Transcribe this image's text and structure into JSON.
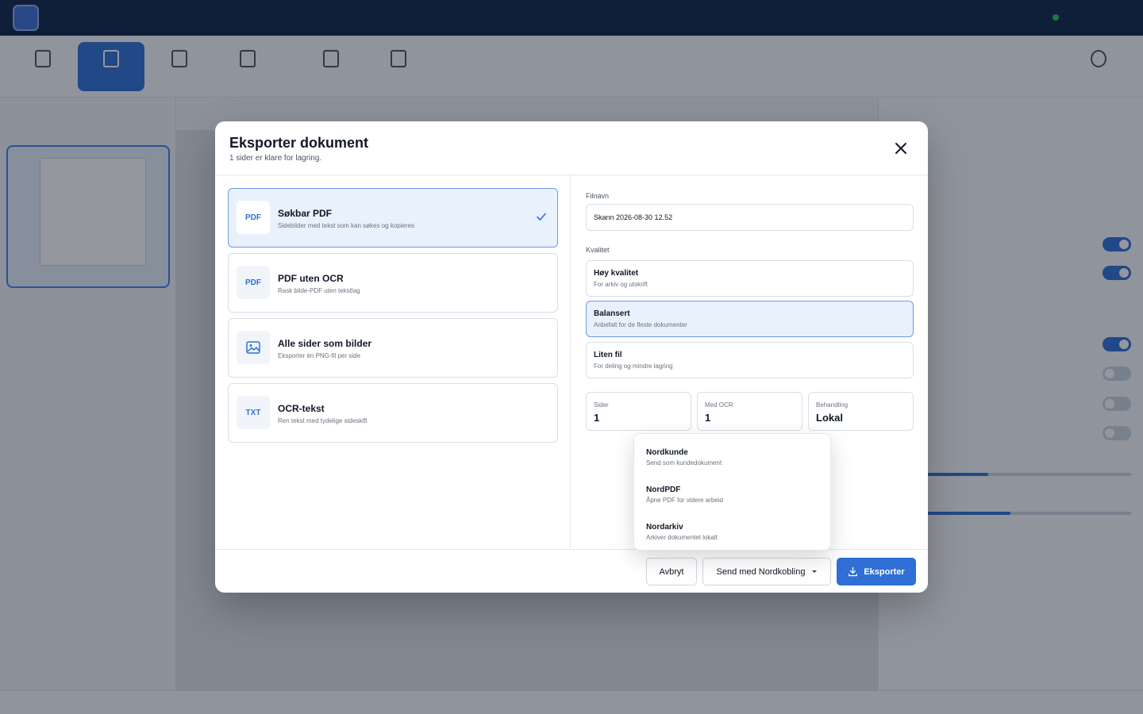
{
  "colors": {
    "accent": "#2f6fd6",
    "selected_bg": "#e9f1fd",
    "titlebar": "#0f2547"
  },
  "modal": {
    "title": "Eksporter dokument",
    "subtitle": "1 sider er klare for lagring.",
    "formats": [
      {
        "icon": "PDF",
        "name": "Søkbar PDF",
        "desc": "Sidebilder med tekst som kan søkes og kopieres",
        "selected": true
      },
      {
        "icon": "PDF",
        "name": "PDF uten OCR",
        "desc": "Rask bilde-PDF uten tekstlag",
        "selected": false
      },
      {
        "icon": "image-icon",
        "name": "Alle sider som bilder",
        "desc": "Eksporter én PNG-fil per side",
        "selected": false
      },
      {
        "icon": "TXT",
        "name": "OCR-tekst",
        "desc": "Ren tekst med tydelige sideskift",
        "selected": false
      }
    ],
    "filename_label": "Filnavn",
    "filename_value": "Skann 2026-08-30 12.52",
    "quality_label": "Kvalitet",
    "qualities": [
      {
        "name": "Høy kvalitet",
        "desc": "For arkiv og utskrift",
        "selected": false
      },
      {
        "name": "Balansert",
        "desc": "Anbefalt for de fleste dokumenter",
        "selected": true
      },
      {
        "name": "Liten fil",
        "desc": "For deling og mindre lagring",
        "selected": false
      }
    ],
    "stats": [
      {
        "label": "Sider",
        "value": "1"
      },
      {
        "label": "Med OCR",
        "value": "1"
      },
      {
        "label": "Behandling",
        "value": "Lokal"
      }
    ],
    "dropdown": [
      {
        "name": "Nordkunde",
        "desc": "Send som kundedokument"
      },
      {
        "name": "NordPDF",
        "desc": "Åpne PDF for videre arbeid"
      },
      {
        "name": "Nordarkiv",
        "desc": "Arkiver dokumentet lokalt"
      }
    ],
    "footer": {
      "cancel": "Avbryt",
      "send": "Send med Nordkobling",
      "export": "Eksporter"
    }
  }
}
